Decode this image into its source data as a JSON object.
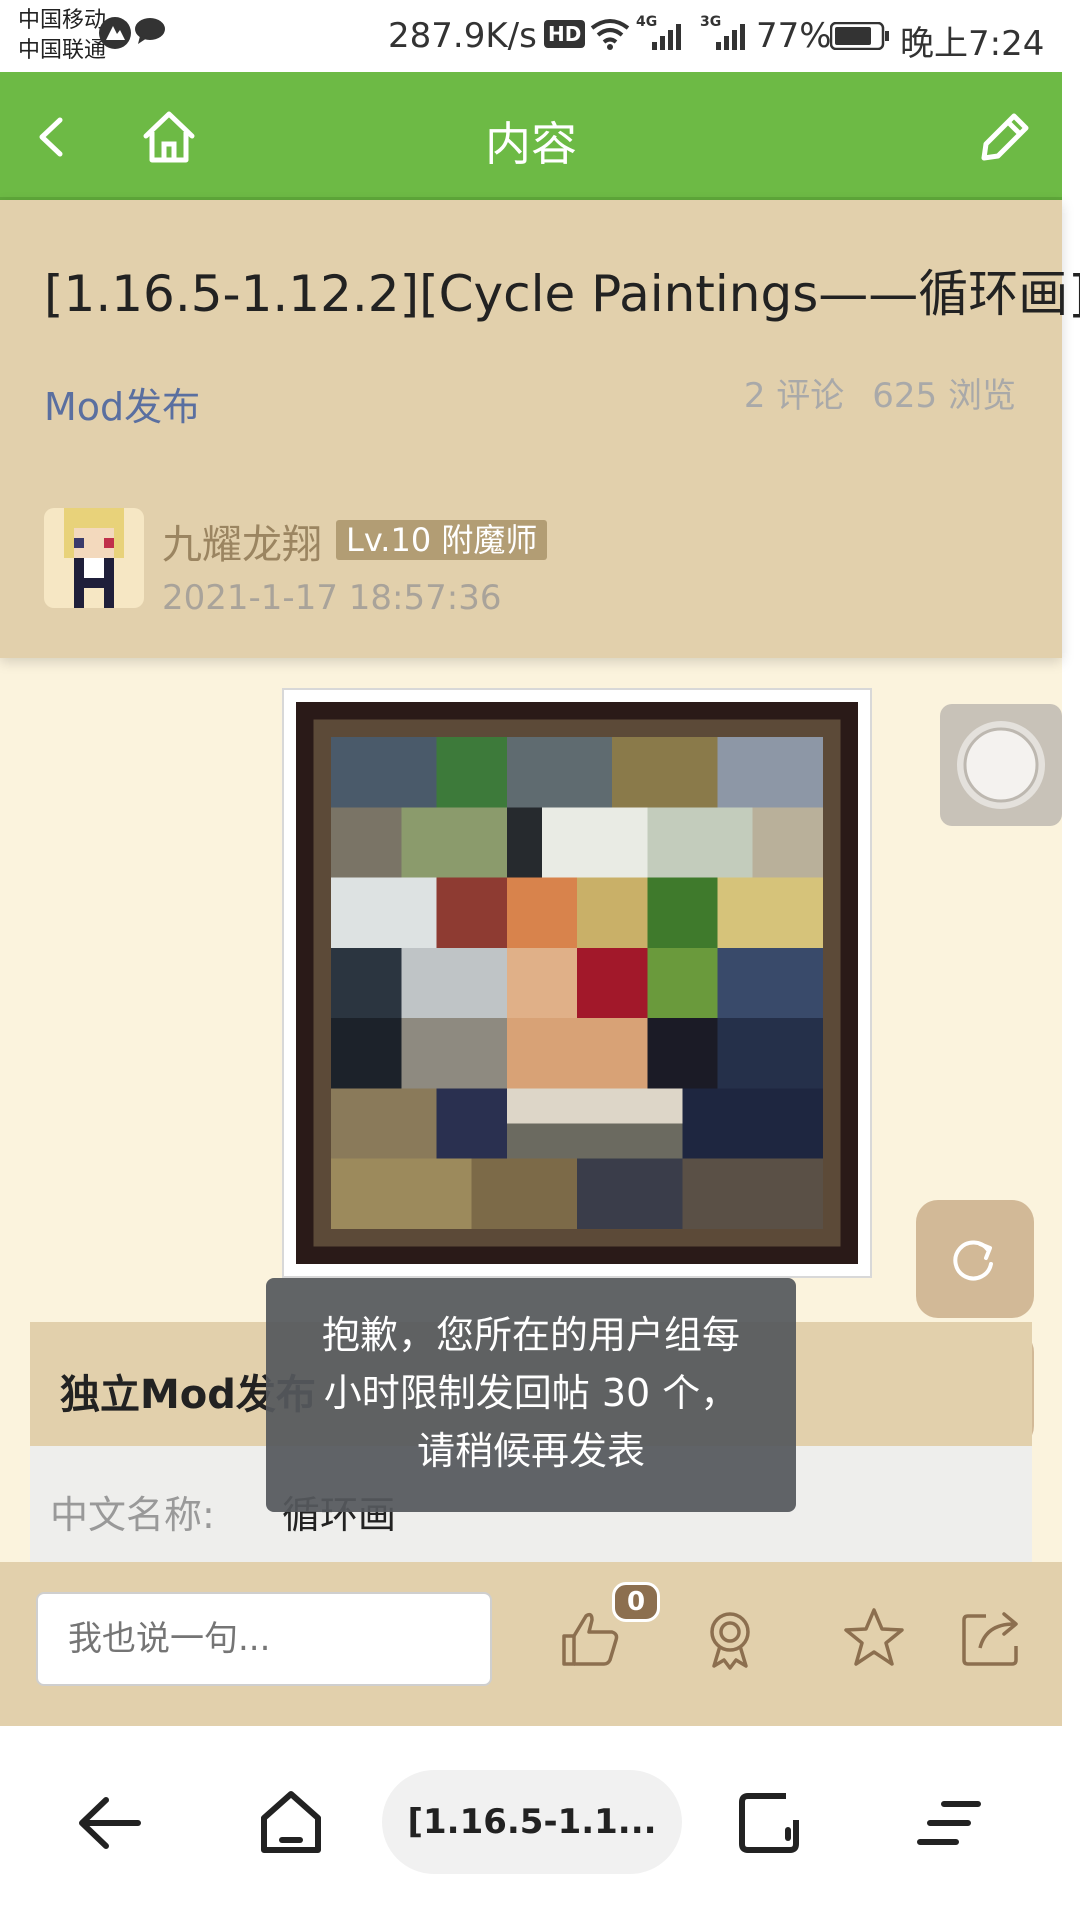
{
  "status_bar": {
    "carrier_1": "中国移动",
    "carrier_2": "中国联通",
    "net_speed": "287.9K/s",
    "hd": "HD",
    "signal_1": "4G",
    "signal_2": "3G",
    "battery": "77%",
    "time": "晚上7:24"
  },
  "app_bar": {
    "title": "内容",
    "icons": [
      "back-icon",
      "home-icon",
      "edit-icon"
    ]
  },
  "post": {
    "title": "[1.16.5-1.12.2][Cycle Paintings——循环画]",
    "category": "Mod发布",
    "comments": "2 评论",
    "views": "625 浏览",
    "author": "九耀龙翔",
    "author_level": "Lv.10 附魔师",
    "time": "2021-1-17 18:57:36"
  },
  "section": {
    "header": "独立Mod发布",
    "row_label": "中文名称:",
    "row_value": "循环画"
  },
  "toast": {
    "message": "抱歉，您所在的用户组每小时限制发回帖 30 个，请稍候再发表"
  },
  "action_bar": {
    "comment_placeholder": "我也说一句...",
    "like_count": "0",
    "icons": [
      "like-icon",
      "award-icon",
      "star-icon",
      "share-icon"
    ]
  },
  "browser": {
    "url_title": "[1.16.5-1.1...",
    "icons": [
      "back-arrow-icon",
      "home-icon",
      "tabs-icon",
      "menu-icon"
    ]
  },
  "colors": {
    "app_bar": "#6dba45",
    "header_bg": "#e2d0ac",
    "page_bg": "#fbf3dd",
    "category_link": "#5a6fa0",
    "author": "#9b8561",
    "toast_bg": "#55585c"
  }
}
